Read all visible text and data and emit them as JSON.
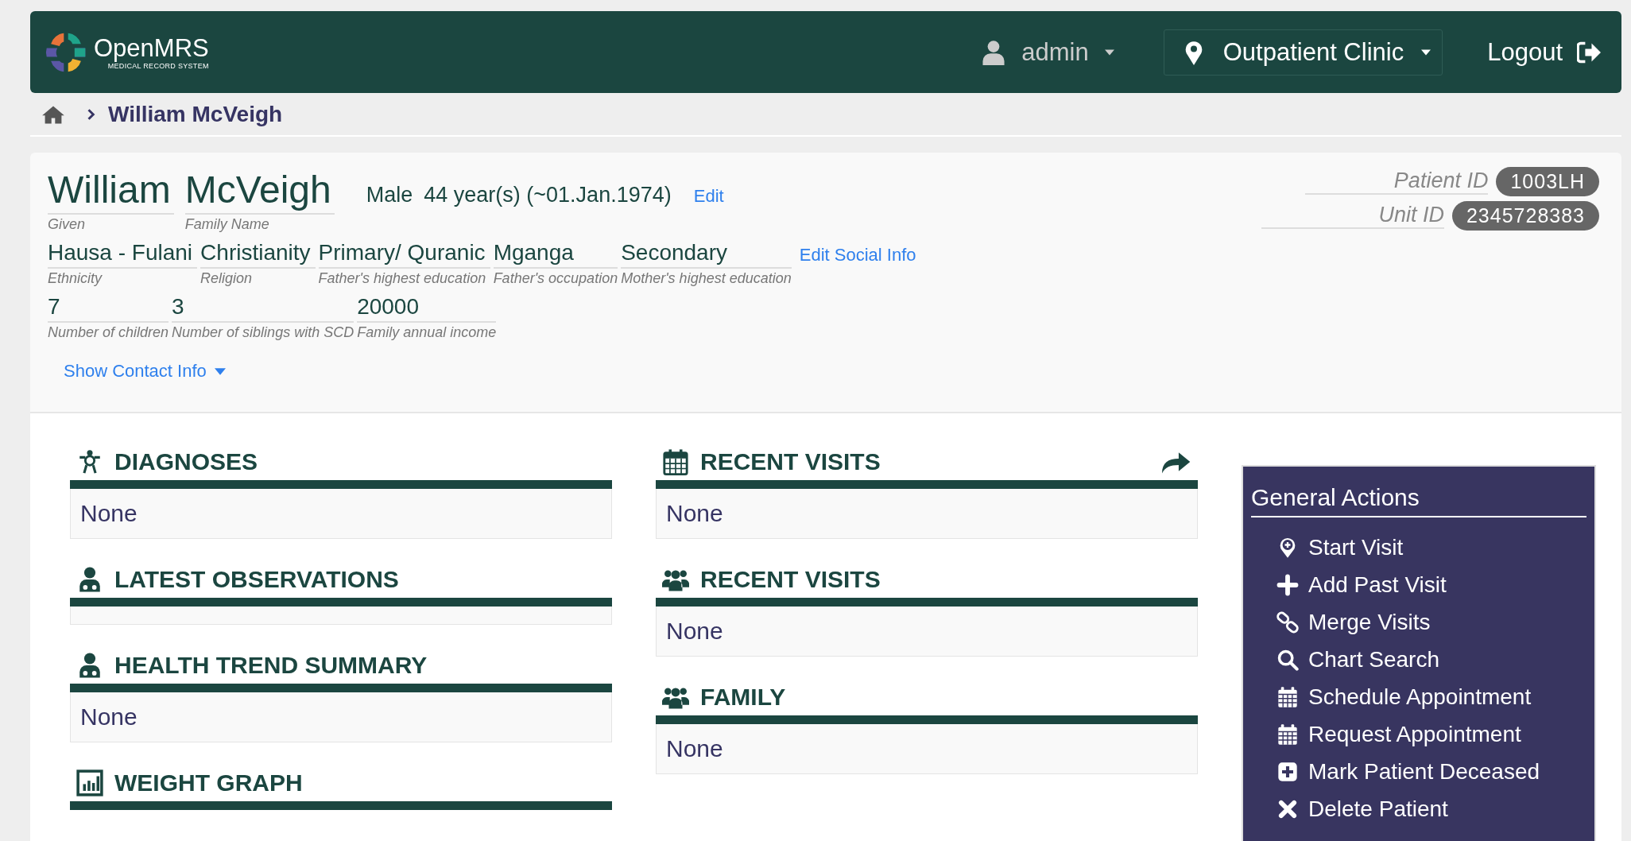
{
  "header": {
    "logo": {
      "name": "OpenMRS",
      "tagline": "MEDICAL RECORD SYSTEM"
    },
    "user": "admin",
    "location": "Outpatient Clinic",
    "logout": "Logout"
  },
  "breadcrumb": {
    "current": "William McVeigh"
  },
  "patient": {
    "given": {
      "value": "William",
      "label": "Given"
    },
    "family": {
      "value": "McVeigh",
      "label": "Family Name"
    },
    "gender": "Male",
    "age": "44 year(s) (~01.Jan.1974)",
    "edit": "Edit",
    "social_rows": [
      [
        {
          "value": "Hausa - Fulani",
          "label": "Ethnicity"
        },
        {
          "value": "Christianity",
          "label": "Religion"
        },
        {
          "value": "Primary/ Quranic",
          "label": "Father's highest education"
        },
        {
          "value": "Mganga",
          "label": "Father's occupation"
        },
        {
          "value": "Secondary",
          "label": "Mother's highest education"
        }
      ],
      [
        {
          "value": "7",
          "label": "Number of children"
        },
        {
          "value": "3",
          "label": "Number of siblings with SCD"
        },
        {
          "value": "20000",
          "label": "Family annual income"
        }
      ]
    ],
    "edit_social": "Edit Social Info",
    "show_contact": "Show Contact Info",
    "identifiers": [
      {
        "label": "Patient ID",
        "value": "1003LH"
      },
      {
        "label": "Unit ID",
        "value": "2345728383"
      }
    ]
  },
  "columns": [
    [
      {
        "title": "DIAGNOSES",
        "kind": "diagnosis",
        "content": "None",
        "link_arrow": false
      },
      {
        "title": "LATEST OBSERVATIONS",
        "kind": "doctor",
        "link_arrow": false
      },
      {
        "title": "HEALTH TREND SUMMARY",
        "kind": "doctor",
        "content": "None",
        "link_arrow": false
      },
      {
        "title": "WEIGHT GRAPH",
        "kind": "chart",
        "link_arrow": false
      }
    ],
    [
      {
        "title": "RECENT VISITS",
        "kind": "calendar",
        "content": "None",
        "link_arrow": true
      },
      {
        "title": "RECENT VISITS",
        "kind": "group",
        "content": "None",
        "link_arrow": false
      },
      {
        "title": "FAMILY",
        "kind": "group",
        "content": "None",
        "link_arrow": false
      }
    ]
  ],
  "general_actions": {
    "title": "General Actions",
    "items": [
      {
        "label": "Start Visit",
        "kind": "pin"
      },
      {
        "label": "Add Past Visit",
        "kind": "plus"
      },
      {
        "label": "Merge Visits",
        "kind": "link"
      },
      {
        "label": "Chart Search",
        "kind": "search"
      },
      {
        "label": "Schedule Appointment",
        "kind": "calendar"
      },
      {
        "label": "Request Appointment",
        "kind": "calendar"
      },
      {
        "label": "Mark Patient Deceased",
        "kind": "plus-square"
      },
      {
        "label": "Delete Patient",
        "kind": "cross"
      }
    ]
  }
}
